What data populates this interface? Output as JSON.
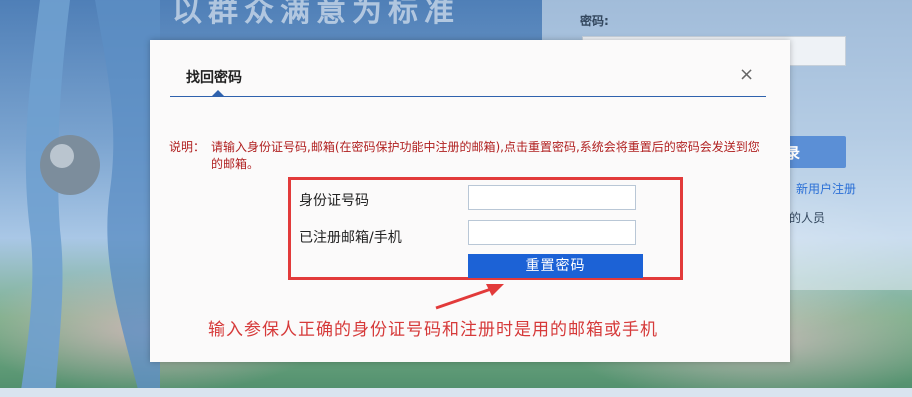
{
  "background": {
    "banner_text": "以群众满意为标准",
    "password_label": "密码:",
    "login_button_label": "录",
    "register_link": "新用户注册",
    "staff_text": "的人员"
  },
  "modal": {
    "tab_title": "找回密码",
    "close_symbol": "×",
    "notice_label": "说明：",
    "notice_body": "请输入身份证号码,邮箱(在密码保护功能中注册的邮箱),点击重置密码,系统会将重置后的密码会发送到您的邮箱。",
    "id_label": "身份证号码",
    "id_value": "",
    "email_label": "已注册邮箱/手机",
    "email_value": "",
    "reset_button": "重置密码"
  },
  "annotation": {
    "text": "输入参保人正确的身份证号码和注册时是用的邮箱或手机",
    "color": "#d63a3a"
  },
  "colors": {
    "accent": "#1c62d6",
    "highlight": "#e23a3a",
    "notice": "#b01f1f"
  }
}
